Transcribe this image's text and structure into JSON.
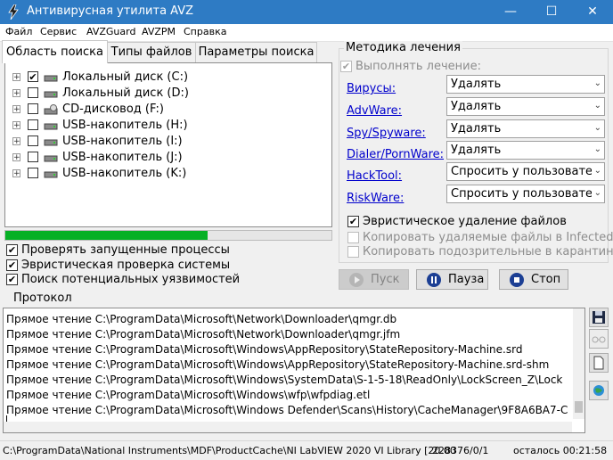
{
  "window": {
    "title": "Антивирусная утилита AVZ",
    "icon": "avz-lightning-icon",
    "accent": "#2e7bc4"
  },
  "menu": [
    "Файл",
    "Сервис",
    "AVZGuard",
    "AVZPM",
    "Справка"
  ],
  "tabs": [
    "Область поиска",
    "Типы файлов",
    "Параметры поиска"
  ],
  "drives": [
    {
      "label": "Локальный диск (C:)",
      "checked": "✔",
      "icon": "hdd-icon"
    },
    {
      "label": "Локальный диск (D:)",
      "checked": "",
      "icon": "hdd-icon"
    },
    {
      "label": "CD-дисковод (F:)",
      "checked": "",
      "icon": "cd-drive-icon"
    },
    {
      "label": "USB-накопитель (H:)",
      "checked": "",
      "icon": "usb-drive-icon"
    },
    {
      "label": "USB-накопитель (I:)",
      "checked": "",
      "icon": "usb-drive-icon"
    },
    {
      "label": "USB-накопитель (J:)",
      "checked": "",
      "icon": "usb-drive-icon"
    },
    {
      "label": "USB-накопитель (K:)",
      "checked": "",
      "icon": "usb-drive-icon"
    }
  ],
  "progress": {
    "fraction": 0.62,
    "color": "#06b025"
  },
  "scan_options": [
    {
      "label": "Проверять запущенные процессы",
      "checked": "✔"
    },
    {
      "label": "Эвристическая проверка системы",
      "checked": "✔"
    },
    {
      "label": "Поиск потенциальных уязвимостей",
      "checked": "✔"
    }
  ],
  "treatment": {
    "title": "Методика лечения",
    "perform": {
      "label": "Выполнять лечение:",
      "checked": "✔"
    },
    "rows": [
      {
        "label": "Вирусы:",
        "value": "Удалять"
      },
      {
        "label": "AdvWare:",
        "value": "Удалять"
      },
      {
        "label": "Spy/Spyware:",
        "value": "Удалять"
      },
      {
        "label": "Dialer/PornWare:",
        "value": "Удалять"
      },
      {
        "label": "HackTool:",
        "value": "Спросить у пользователя"
      },
      {
        "label": "RiskWare:",
        "value": "Спросить у пользователя"
      }
    ],
    "heuristic_delete": {
      "label": "Эвристическое удаление файлов",
      "checked": "✔"
    },
    "copy_deleted": {
      "label": "Копировать удаляемые файлы в  Infected",
      "checked": ""
    },
    "copy_suspicious": {
      "label": "Копировать подозрительные в  карантин",
      "checked": ""
    }
  },
  "buttons": {
    "start": "Пуск",
    "pause": "Пауза",
    "stop": "Стоп"
  },
  "protocol": {
    "title": "Протокол",
    "lines": [
      "Прямое чтение C:\\ProgramData\\Microsoft\\Network\\Downloader\\qmgr.db",
      "Прямое чтение C:\\ProgramData\\Microsoft\\Network\\Downloader\\qmgr.jfm",
      "Прямое чтение C:\\ProgramData\\Microsoft\\Windows\\AppRepository\\StateRepository-Machine.srd",
      "Прямое чтение C:\\ProgramData\\Microsoft\\Windows\\AppRepository\\StateRepository-Machine.srd-shm",
      "Прямое чтение C:\\ProgramData\\Microsoft\\Windows\\SystemData\\S-1-5-18\\ReadOnly\\LockScreen_Z\\Lock",
      "Прямое чтение C:\\ProgramData\\Microsoft\\Windows\\wfp\\wfpdiag.etl",
      "Прямое чтение C:\\ProgramData\\Microsoft\\Windows Defender\\Scans\\History\\CacheManager\\9F8A6BA7-C"
    ]
  },
  "side_icons": [
    "save-icon",
    "glasses-icon",
    "document-icon",
    "globe-icon"
  ],
  "status": {
    "path": "C:\\ProgramData\\National Instruments\\MDF\\ProductCache\\NI LabVIEW 2020 VI Library [20.00",
    "counter": "228376/0/1",
    "remaining": "осталось 00:21:58"
  }
}
